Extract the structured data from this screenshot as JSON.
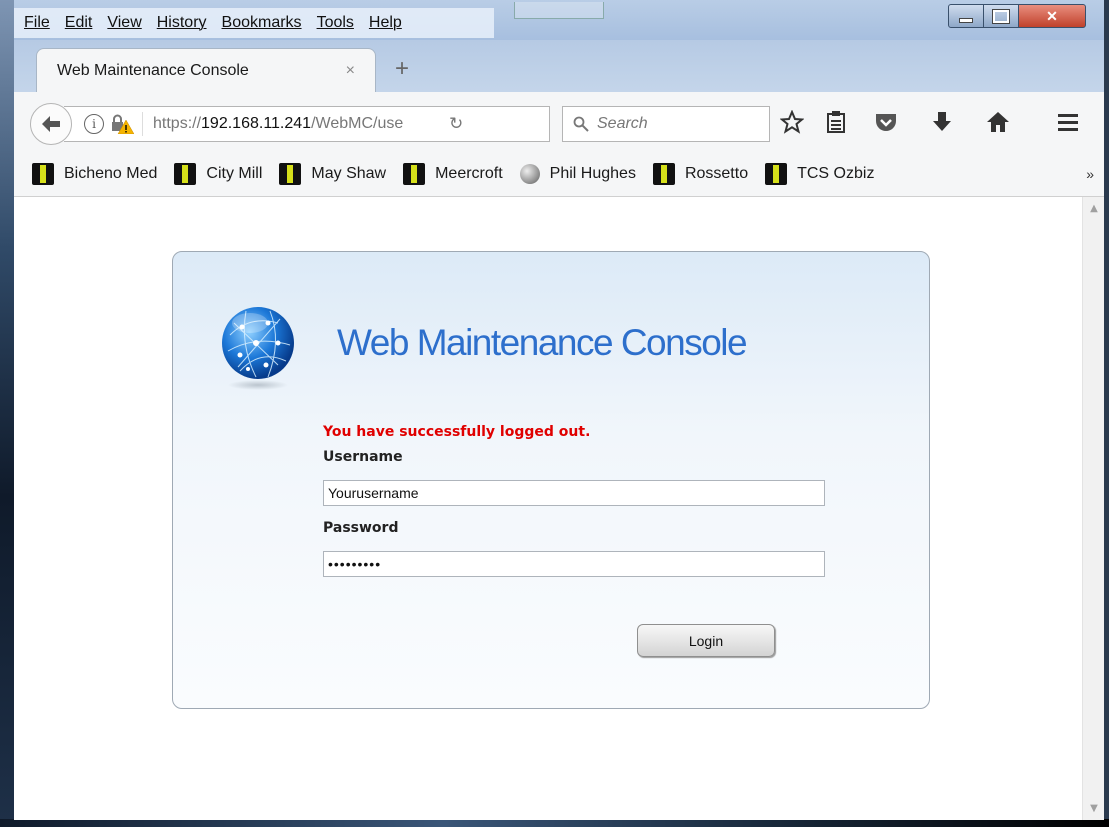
{
  "menu": [
    "File",
    "Edit",
    "View",
    "History",
    "Bookmarks",
    "Tools",
    "Help"
  ],
  "tab": {
    "title": "Web Maintenance Console",
    "close": "×",
    "new_tab": "+"
  },
  "url": {
    "scheme": "https://",
    "host": "192.168.11.241",
    "path": "/WebMC/use"
  },
  "search": {
    "placeholder": "Search"
  },
  "bookmarks": [
    "Bicheno Med",
    "City Mill",
    "May Shaw",
    "Meercroft",
    "Phil Hughes",
    "Rossetto",
    "TCS Ozbiz"
  ],
  "bookmarks_more": "»",
  "page": {
    "heading": "Web Maintenance Console",
    "message": "You have successfully logged out.",
    "username_label": "Username",
    "username_value": "Yourusername",
    "password_label": "Password",
    "password_value": "•••••••••",
    "login_button": "Login"
  },
  "colors": {
    "message": "#e00000",
    "heading": "#2d6fcc"
  }
}
